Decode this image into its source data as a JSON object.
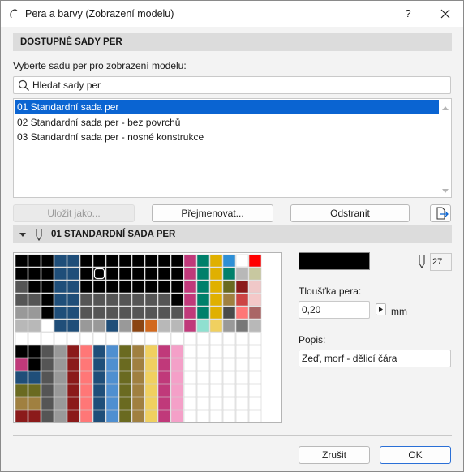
{
  "window": {
    "title": "Pera a barvy (Zobrazení modelu)",
    "help_label": "?"
  },
  "section1": {
    "title": "DOSTUPNÉ SADY PER",
    "prompt": "Vyberte sadu per pro zobrazení modelu:"
  },
  "search": {
    "placeholder": "Hledat sady per"
  },
  "pen_sets": [
    {
      "label": "01 Standardní sada per",
      "selected": true
    },
    {
      "label": "02 Standardní sada per - bez povrchů",
      "selected": false
    },
    {
      "label": "03 Standardní sada per - nosné konstrukce",
      "selected": false
    }
  ],
  "buttons": {
    "save_as": "Uložit jako...",
    "rename": "Přejmenovat...",
    "delete": "Odstranit",
    "cancel": "Zrušit",
    "ok": "OK"
  },
  "section2": {
    "title": "01 STANDARDNÍ SADA PER"
  },
  "pen": {
    "number": "27",
    "color": "#000000",
    "thickness_label": "Tloušťka pera:",
    "thickness_value": "0,20",
    "unit": "mm",
    "description_label": "Popis:",
    "description_value": "Zeď, morf - dělicí čára"
  },
  "pen_palette": {
    "selected_index": 6,
    "rows": [
      [
        "#000000",
        "#000000",
        "#000000",
        "#1f4e79",
        "#1f4e79",
        "#000000",
        "#000000",
        "#000000",
        "#000000",
        "#000000",
        "#000000",
        "#000000",
        "#000000",
        "#c0397a",
        "#00806b",
        "#e0b000",
        "#2e8fd6",
        "#ffffff",
        "#ff0000"
      ],
      [
        "#000000",
        "#000000",
        "#000000",
        "#1f4e79",
        "#1f4e79",
        "#000000",
        "#000000",
        "#000000",
        "#000000",
        "#000000",
        "#000000",
        "#000000",
        "#000000",
        "#c0397a",
        "#00806b",
        "#e0b000",
        "#00806b",
        "#b8b8b8",
        "#c8c8a0"
      ],
      [
        "#555555",
        "#000000",
        "#000000",
        "#1f4e79",
        "#1f4e79",
        "#000000",
        "#000000",
        "#000000",
        "#000000",
        "#000000",
        "#000000",
        "#000000",
        "#000000",
        "#c0397a",
        "#00806b",
        "#e0b000",
        "#6a6a20",
        "#8b1a1a",
        "#f0c8c8"
      ],
      [
        "#555555",
        "#555555",
        "#000000",
        "#1f4e79",
        "#1f4e79",
        "#555555",
        "#555555",
        "#555555",
        "#555555",
        "#555555",
        "#555555",
        "#555555",
        "#000000",
        "#c0397a",
        "#00806b",
        "#e0b000",
        "#a08040",
        "#cc4444",
        "#f4c8c8"
      ],
      [
        "#999999",
        "#999999",
        "#000000",
        "#1f4e79",
        "#1f4e79",
        "#555555",
        "#555555",
        "#555555",
        "#555555",
        "#555555",
        "#555555",
        "#555555",
        "#555555",
        "#c0397a",
        "#00806b",
        "#e0b000",
        "#4a4a4a",
        "#ff7777",
        "#aa6666"
      ],
      [
        "#b8b8b8",
        "#b8b8b8",
        "#ffffff",
        "#1f4e79",
        "#1f4e79",
        "#999999",
        "#999999",
        "#1f4e79",
        "#999999",
        "#8b4513",
        "#d2691e",
        "#b8b8b8",
        "#b8b8b8",
        "#c0397a",
        "#8fe0d0",
        "#f0d060",
        "#999999",
        "#777777",
        "#b8b8b8"
      ],
      [
        "#ffffff",
        "#ffffff",
        "#ffffff",
        "#ffffff",
        "#ffffff",
        "#ffffff",
        "#ffffff",
        "#ffffff",
        "#ffffff",
        "#ffffff",
        "#ffffff",
        "#ffffff",
        "#ffffff",
        "#ffffff",
        "#ffffff",
        "#ffffff",
        "#ffffff",
        "#ffffff",
        "#ffffff"
      ],
      [
        "#000000",
        "#000000",
        "#555555",
        "#999999",
        "#8b1a1a",
        "#ff7777",
        "#1f4e79",
        "#4f8fd0",
        "#6a6a20",
        "#a08040",
        "#f0d060",
        "#c0397a",
        "#f4a0c8",
        "#ffffff",
        "#ffffff",
        "#ffffff",
        "#ffffff",
        "#ffffff",
        "#ffffff"
      ],
      [
        "#c0397a",
        "#000000",
        "#555555",
        "#999999",
        "#8b1a1a",
        "#ff7777",
        "#1f4e79",
        "#4f8fd0",
        "#6a6a20",
        "#a08040",
        "#f0d060",
        "#c0397a",
        "#f4a0c8",
        "#ffffff",
        "#ffffff",
        "#ffffff",
        "#ffffff",
        "#ffffff",
        "#ffffff"
      ],
      [
        "#1f4e79",
        "#1f4e79",
        "#555555",
        "#999999",
        "#8b1a1a",
        "#ff7777",
        "#1f4e79",
        "#4f8fd0",
        "#6a6a20",
        "#a08040",
        "#f0d060",
        "#c0397a",
        "#f4a0c8",
        "#ffffff",
        "#ffffff",
        "#ffffff",
        "#ffffff",
        "#ffffff",
        "#ffffff"
      ],
      [
        "#6a6a20",
        "#6a6a20",
        "#555555",
        "#999999",
        "#8b1a1a",
        "#ff7777",
        "#1f4e79",
        "#4f8fd0",
        "#6a6a20",
        "#a08040",
        "#f0d060",
        "#c0397a",
        "#f4a0c8",
        "#ffffff",
        "#ffffff",
        "#ffffff",
        "#ffffff",
        "#ffffff",
        "#ffffff"
      ],
      [
        "#a08040",
        "#a08040",
        "#555555",
        "#999999",
        "#8b1a1a",
        "#ff7777",
        "#1f4e79",
        "#4f8fd0",
        "#6a6a20",
        "#a08040",
        "#f0d060",
        "#c0397a",
        "#f4a0c8",
        "#ffffff",
        "#ffffff",
        "#ffffff",
        "#ffffff",
        "#ffffff",
        "#ffffff"
      ],
      [
        "#8b1a1a",
        "#8b1a1a",
        "#555555",
        "#999999",
        "#8b1a1a",
        "#ff7777",
        "#1f4e79",
        "#4f8fd0",
        "#6a6a20",
        "#a08040",
        "#f0d060",
        "#c0397a",
        "#f4a0c8",
        "#ffffff",
        "#ffffff",
        "#ffffff",
        "#ffffff",
        "#ffffff",
        "#ffffff"
      ]
    ]
  }
}
